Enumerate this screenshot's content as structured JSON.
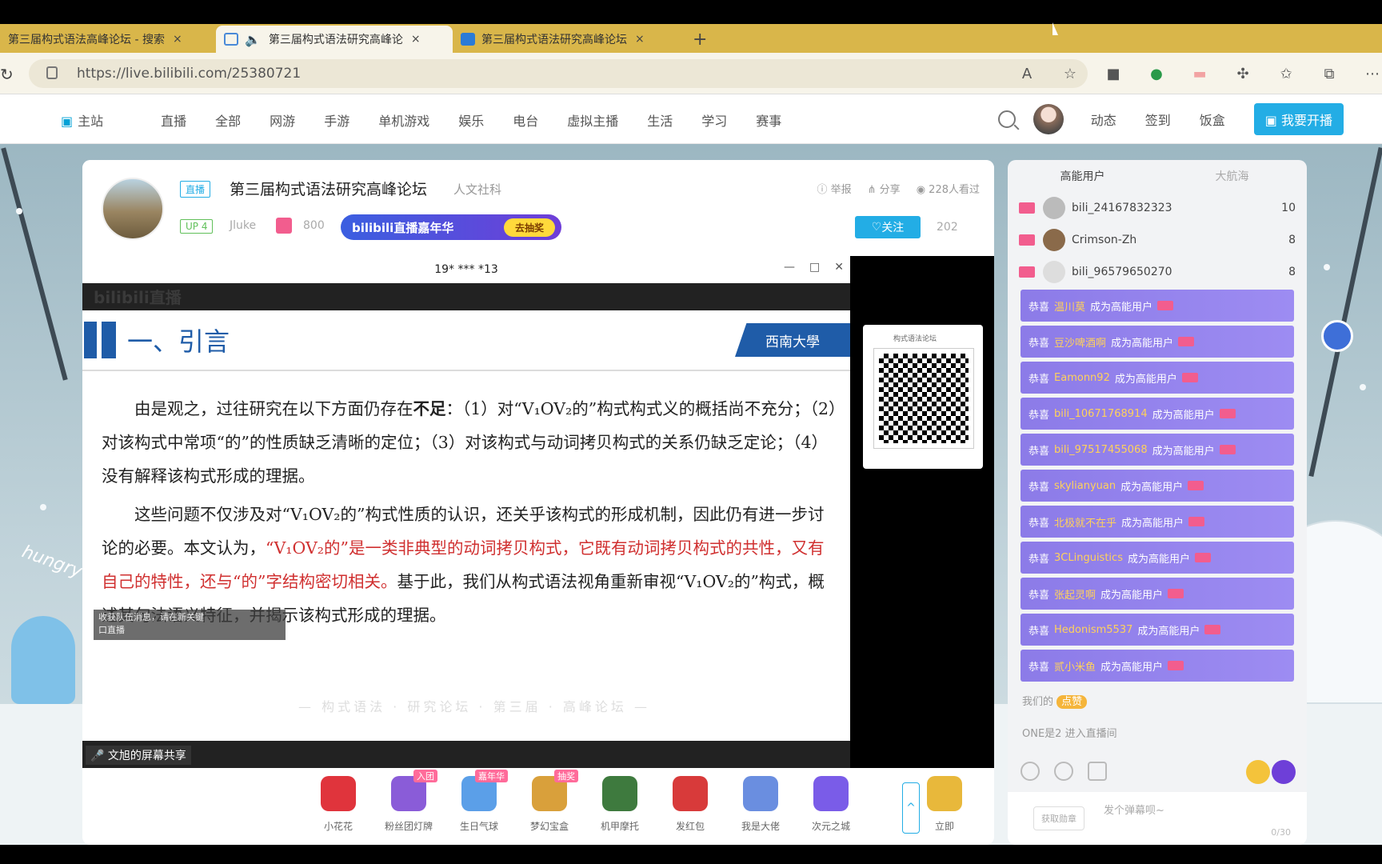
{
  "browser": {
    "tabs": [
      {
        "title": "第三届构式语法高峰论坛 - 搜索",
        "close": "×"
      },
      {
        "title": "第三届构式语法研究高峰论",
        "close": "×"
      },
      {
        "title": "第三届构式语法研究高峰论坛",
        "close": "×"
      }
    ],
    "new_tab": "+",
    "url": "https://live.bilibili.com/25380721"
  },
  "nav": {
    "items": [
      "主站",
      "直播",
      "全部",
      "网游",
      "手游",
      "单机游戏",
      "娱乐",
      "电台",
      "虚拟主播",
      "生活",
      "学习",
      "赛事"
    ],
    "right_links": [
      "动态",
      "签到",
      "饭盒"
    ],
    "live_button": "我要开播"
  },
  "room": {
    "live_badge": "直播",
    "title": "第三届构式语法研究高峰论坛",
    "category": "人文社科",
    "up_badge": "UP 4",
    "up_name": "Jluke",
    "gift_count": "800",
    "banner_text": "bilibili直播嘉年华",
    "banner_button": "去抽奖",
    "actions": {
      "report": "举报",
      "share": "分享",
      "viewers": "228人看过"
    },
    "follow_label": "关注",
    "follow_count": "202"
  },
  "share_window": {
    "title": "19* *** *13",
    "watermark": "bilibili直播",
    "bottom_label": "文旭的屏幕共享",
    "notice_line1": "收获队伍消息，请在新关键",
    "notice_line2": "口直播"
  },
  "slide": {
    "heading": "一、引言",
    "logo": "西南大學",
    "p1_a": "由是观之，过往研究在以下方面仍存在",
    "p1_bold": "不足",
    "p1_b": "：（1）对“V₁OV₂的”构式构式义的概括尚不充分；（2）对该构式中常项“的”的性质缺乏清晰的定位；（3）对该构式与动词拷贝构式的关系仍缺乏定论；（4）没有解释该构式形成的理据。",
    "p2_a": "这些问题不仅涉及对“V₁OV₂的”构式性质的认识，还关乎该构式的形成机制，因此仍有进一步讨论的必要。本文认为，",
    "p2_red": "“V₁OV₂的”是一类非典型的动词拷贝构式，它既有动词拷贝构式的共性，又有自己的特性，还与“的”字结构密切相关。",
    "p2_b": "基于此，我们从构式语法视角重新审视“V₁OV₂的”构式，概述其句法语义特征，并揭示该构式形成的理据。",
    "faint_footer": "— 构式语法 · 研究论坛 · 第三届 · 高峰论坛 —"
  },
  "qr": {
    "title": "构式语法论坛"
  },
  "gifts": [
    {
      "name": "小花花",
      "tag": "",
      "color": "#e0343c"
    },
    {
      "name": "粉丝团灯牌",
      "tag": "入团",
      "color": "#8a5cd8"
    },
    {
      "name": "生日气球",
      "tag": "嘉年华",
      "color": "#5b9fe8"
    },
    {
      "name": "梦幻宝盒",
      "tag": "抽奖",
      "color": "#d9a03b"
    },
    {
      "name": "机甲摩托",
      "tag": "",
      "color": "#3e7a3e"
    },
    {
      "name": "发红包",
      "tag": "",
      "color": "#d83a3a"
    },
    {
      "name": "我是大佬",
      "tag": "",
      "color": "#6a8ee0"
    },
    {
      "name": "次元之城",
      "tag": "",
      "color": "#7a5ce8"
    },
    {
      "name": "立即",
      "tag": "",
      "color": "#e8b83b"
    }
  ],
  "chat": {
    "tabs": [
      "高能用户",
      "大航海"
    ],
    "ranks": [
      {
        "name": "bili_24167832323",
        "num": "10"
      },
      {
        "name": "Crimson-Zh",
        "num": "8"
      },
      {
        "name": "bili_96579650270",
        "num": "8"
      }
    ],
    "congrats_prefix": "恭喜",
    "congrats_suffix": "成为高能用户",
    "messages": [
      "温川莫",
      "豆沙啤酒啊",
      "Eamonn92",
      "bili_10671768914",
      "bili_97517455068",
      "skylianyuan",
      "北极就不在乎",
      "3CLinguistics",
      "张起灵啊",
      "Hedonism5537",
      "贰小米鱼"
    ],
    "sys_line1": "我们的",
    "sys_badge": "点赞",
    "sys_line2": "ONE是2 进入直播间",
    "input_button": "获取勋章",
    "input_placeholder": "发个弹幕呗~",
    "input_count": "0/30"
  },
  "decor": {
    "hungry": "hungry"
  }
}
